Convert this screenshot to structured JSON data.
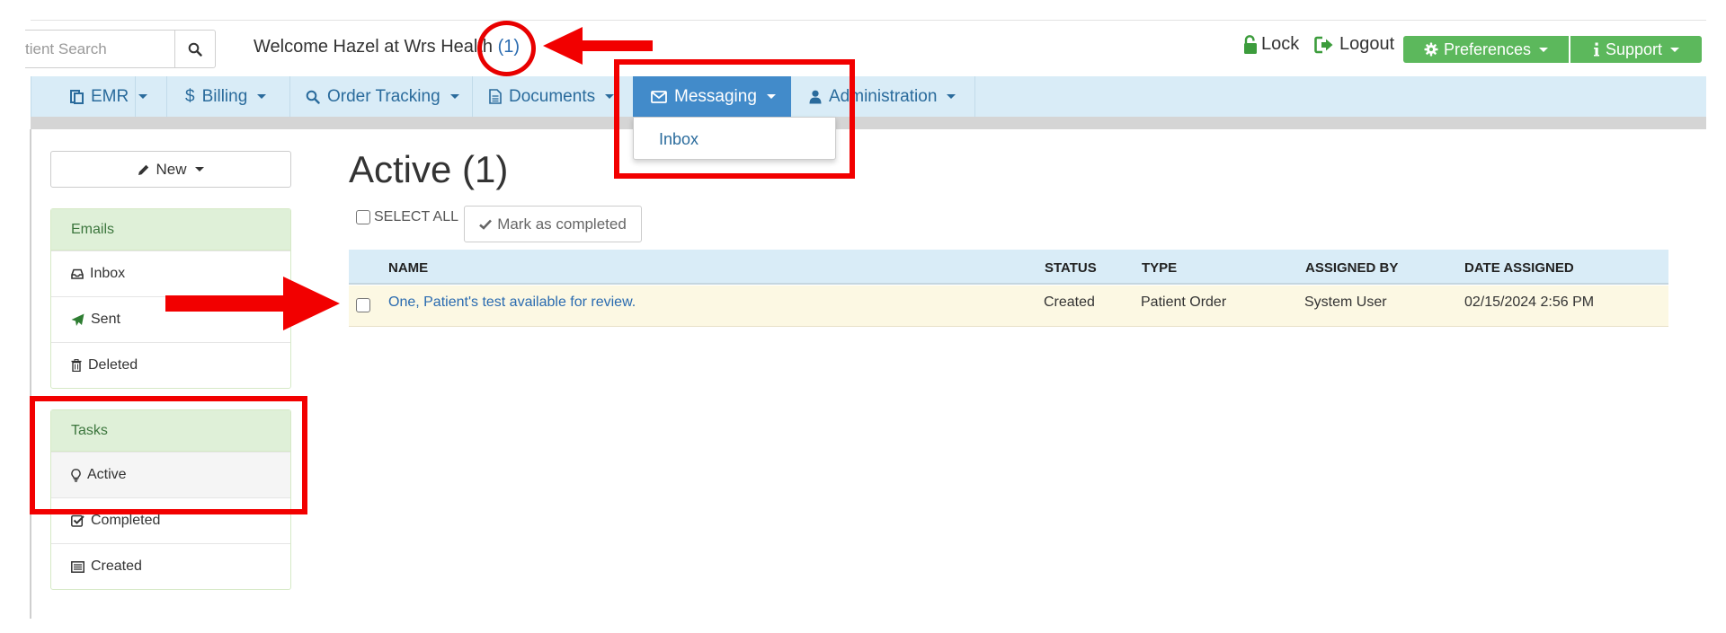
{
  "header": {
    "search_placeholder": "tient Search",
    "welcome_text": "Welcome Hazel at Wrs Health ",
    "message_count": "(1)",
    "lock_label": "Lock",
    "logout_label": "Logout",
    "preferences_label": "Preferences",
    "support_label": "Support"
  },
  "nav": {
    "items": [
      {
        "label": "EMR"
      },
      {
        "label": "Billing"
      },
      {
        "label": "Order Tracking"
      },
      {
        "label": "Documents"
      },
      {
        "label": "Messaging"
      },
      {
        "label": "Administration"
      }
    ],
    "dropdown_item": "Inbox"
  },
  "sidebar": {
    "new_label": "New",
    "emails": {
      "title": "Emails",
      "items": [
        {
          "label": "Inbox"
        },
        {
          "label": "Sent"
        },
        {
          "label": "Deleted"
        }
      ]
    },
    "tasks": {
      "title": "Tasks",
      "items": [
        {
          "label": "Active"
        },
        {
          "label": "Completed"
        },
        {
          "label": "Created"
        }
      ]
    }
  },
  "main": {
    "heading": "Active (1)",
    "select_all": "SELECT ALL",
    "mark_completed": "Mark as completed",
    "columns": [
      "NAME",
      "STATUS",
      "TYPE",
      "ASSIGNED BY",
      "DATE ASSIGNED"
    ],
    "rows": [
      {
        "name": "One, Patient's test available for review.",
        "status": "Created",
        "type": "Patient Order",
        "assigned_by": "System User",
        "date_assigned": "02/15/2024 2:56 PM"
      }
    ]
  },
  "colors": {
    "accent_blue": "#428bca",
    "nav_bg": "#d9ecf7",
    "success_green": "#5cb85c",
    "annotation_red": "#f20000",
    "row_highlight": "#fcf8e3"
  }
}
